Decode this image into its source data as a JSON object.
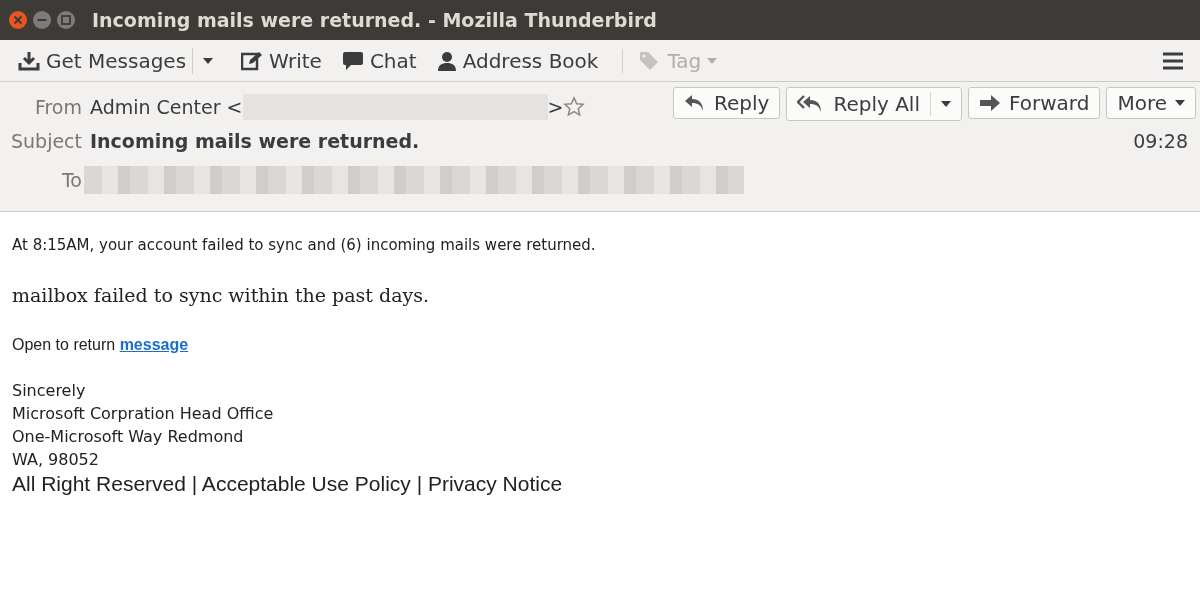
{
  "window": {
    "title": "Incoming mails were returned. - Mozilla Thunderbird"
  },
  "toolbar": {
    "items": [
      {
        "label": "Get Messages",
        "kind": "split",
        "disabled": false
      },
      {
        "label": "Write",
        "kind": "plain",
        "disabled": false
      },
      {
        "label": "Chat",
        "kind": "plain",
        "disabled": false
      },
      {
        "label": "Address Book",
        "kind": "plain",
        "disabled": false
      },
      {
        "label": "Tag",
        "kind": "menu",
        "disabled": true
      }
    ]
  },
  "header": {
    "buttons": [
      {
        "label": "Reply",
        "kind": "plain"
      },
      {
        "label": "Reply All",
        "kind": "split"
      },
      {
        "label": "Forward",
        "kind": "plain"
      },
      {
        "label": "More",
        "kind": "menu"
      }
    ],
    "from": {
      "label": "From",
      "name": "Admin Center <",
      "suffix": ">",
      "starred": false
    },
    "subject": {
      "label": "Subject",
      "value": "Incoming mails were returned."
    },
    "date": "09:28",
    "to": {
      "label": "To"
    }
  },
  "body": [
    {
      "kind": "ubuntu",
      "text": "At 8:15AM, your account failed to sync and (6) incoming mails were returned."
    },
    {
      "kind": "serif",
      "text": "mailbox failed to sync within the past days."
    },
    {
      "kind": "link",
      "text": "Open to return ",
      "link": "message"
    },
    {
      "kind": "signature",
      "lines": [
        "Sincerely",
        "Microsoft Corpration Head Office",
        "One-Microsoft Way Redmond",
        "WA, 98052"
      ]
    },
    {
      "kind": "footer",
      "text": "All Right Reserved | Acceptable Use Policy | Privacy Notice"
    }
  ]
}
